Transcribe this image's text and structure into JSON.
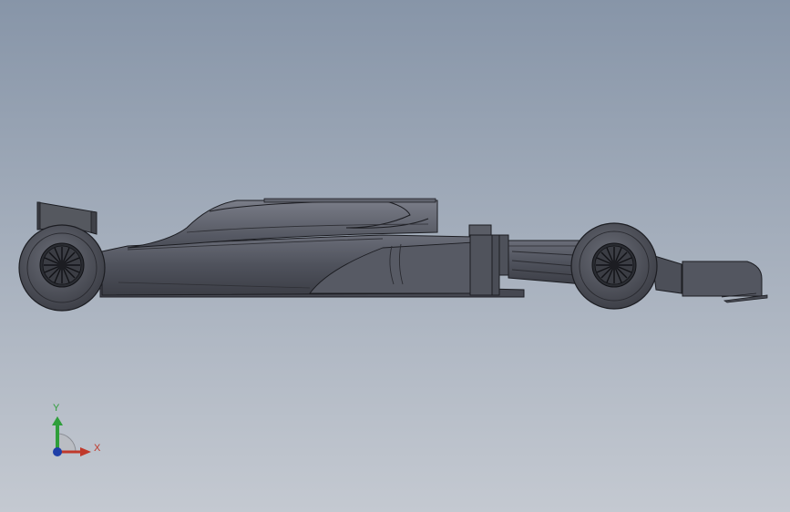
{
  "viewport": {
    "background_top": "#8795a8",
    "background_bottom": "#c4c9d1"
  },
  "model": {
    "body_color": "#50535d",
    "edge_color": "#1c1d22"
  },
  "triad": {
    "x_label": "X",
    "y_label": "Y",
    "x_color": "#c0392b",
    "y_color": "#2e9e3a",
    "z_color": "#1f3fa8"
  }
}
